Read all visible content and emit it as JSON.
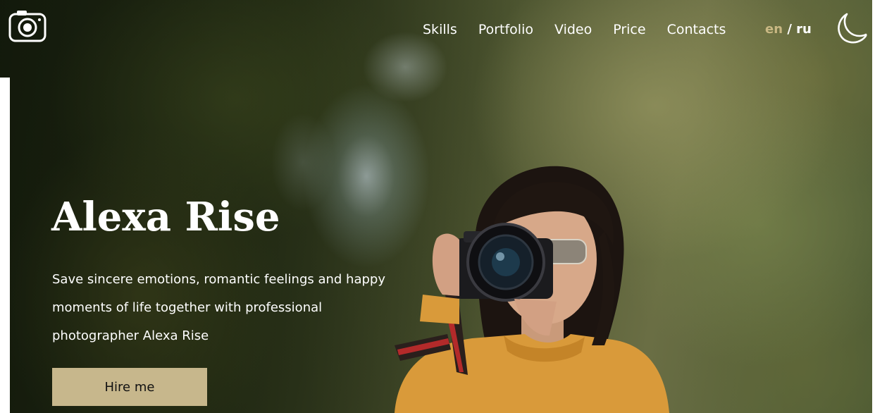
{
  "header": {
    "logo_icon": "camera-icon",
    "nav": [
      {
        "label": "Skills"
      },
      {
        "label": "Portfolio"
      },
      {
        "label": "Video"
      },
      {
        "label": "Price"
      },
      {
        "label": "Contacts"
      }
    ],
    "lang": {
      "en": "en",
      "sep": "/",
      "ru": "ru",
      "active": "en"
    },
    "theme_icon": "moon-icon"
  },
  "hero": {
    "title": "Alexa Rise",
    "text": "Save sincere emotions, romantic feelings and happy moments of life together with professional photographer Alexa Rise",
    "button_label": "Hire me",
    "image": "photographer-with-camera-image"
  },
  "colors": {
    "accent": "#c7b78c",
    "active_lang": "#c9b883",
    "text": "#ffffff"
  }
}
